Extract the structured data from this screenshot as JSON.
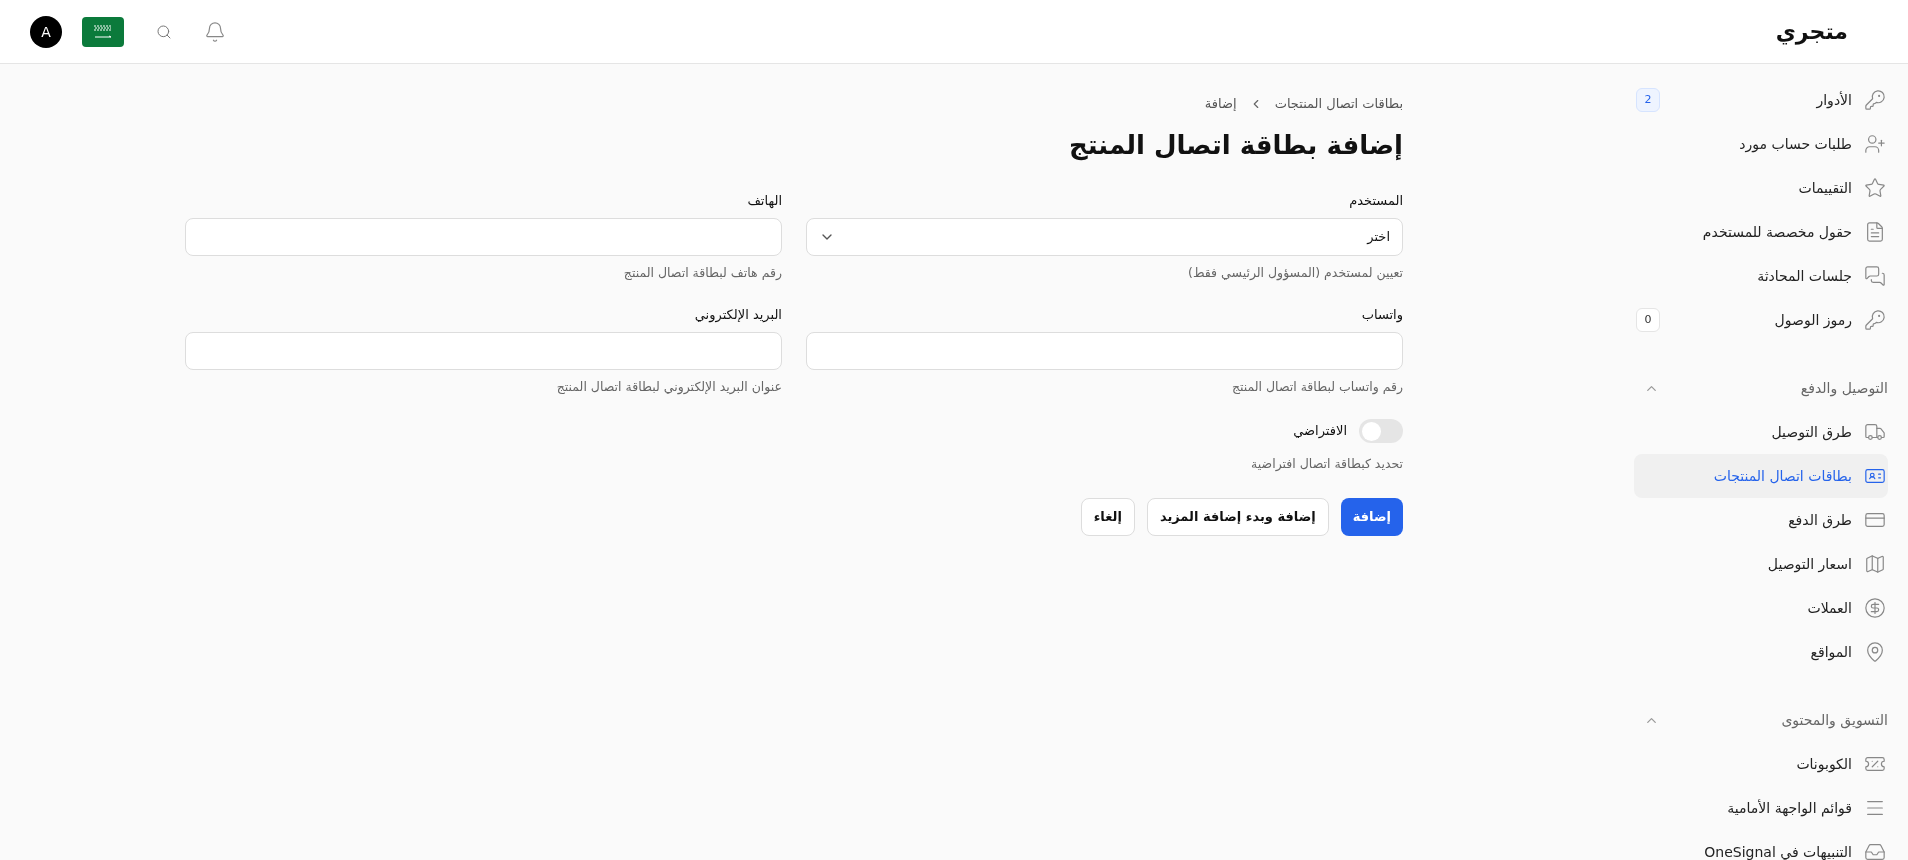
{
  "header": {
    "logo": "متجري",
    "avatar": "A"
  },
  "sidebar": {
    "groups": [
      {
        "items": [
          {
            "label": "الأدوار",
            "badge": {
              "text": "2",
              "highlighted": true
            },
            "selected": false
          },
          {
            "label": "طلبات حساب مورد",
            "selected": false
          },
          {
            "label": "التقييمات",
            "selected": false
          },
          {
            "label": "حقول مخصصة للمستخدم",
            "selected": false
          },
          {
            "label": "جلسات المحادثة",
            "selected": false
          },
          {
            "label": "رموز الوصول",
            "badge": {
              "text": "0",
              "highlighted": false
            },
            "selected": false
          }
        ]
      },
      {
        "title": "التوصيل والدفع",
        "expanded": true,
        "items": [
          {
            "label": "طرق التوصيل",
            "selected": false
          },
          {
            "label": "بطاقات اتصال المنتجات",
            "selected": true
          },
          {
            "label": "طرق الدفع",
            "selected": false
          },
          {
            "label": "اسعار التوصيل",
            "selected": false
          },
          {
            "label": "العملات",
            "selected": false
          },
          {
            "label": "المواقع",
            "selected": false
          }
        ]
      },
      {
        "title": "التسويق والمحتوى",
        "expanded": true,
        "items": [
          {
            "label": "الكوبونات",
            "selected": false
          },
          {
            "label": "قوائم الواجهة الأمامية",
            "selected": false
          },
          {
            "label": "التنبيهات في OneSignal",
            "selected": false
          }
        ]
      }
    ]
  },
  "breadcrumb": [
    "بطاقات اتصال المنتجات",
    "إضافة"
  ],
  "title": "إضافة بطاقة اتصال المنتج",
  "fields": [
    {
      "kind": "select",
      "label": "المستخدم",
      "value": "اختر",
      "help": "تعيين لمستخدم (المسؤول الرئيسي فقط)"
    },
    {
      "kind": "text",
      "label": "الهاتف",
      "help": "رقم هاتف لبطاقة اتصال المنتج"
    },
    {
      "kind": "text",
      "label": "واتساب",
      "help": "رقم واتساب لبطاقة اتصال المنتج"
    },
    {
      "kind": "text",
      "label": "البريد الإلكتروني",
      "help": "عنوان البريد الإلكتروني لبطاقة اتصال المنتج"
    }
  ],
  "toggle": {
    "label": "الافتراضي",
    "on": false,
    "help": "تحديد كبطاقة اتصال افتراضية"
  },
  "buttons": [
    {
      "label": "إضافة",
      "kind": "primary"
    },
    {
      "label": "إضافة وبدء إضافة المزيد",
      "kind": "secondary"
    },
    {
      "label": "إلغاء",
      "kind": "secondary"
    }
  ]
}
